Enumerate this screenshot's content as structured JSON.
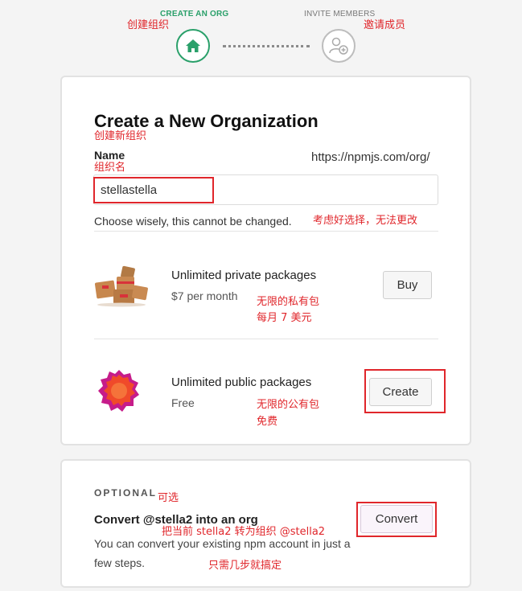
{
  "steps": {
    "create": {
      "label": "CREATE AN ORG",
      "annotation": "创建组织",
      "icon": "home-icon"
    },
    "invite": {
      "label": "INVITE MEMBERS",
      "annotation": "邀请成员",
      "icon": "add-user-icon"
    }
  },
  "form": {
    "title": "Create a New Organization",
    "title_annotation": "创建新组织",
    "name_label": "Name",
    "name_annotation": "组织名",
    "url_prefix": "https://npmjs.com/org/",
    "name_value": "stellastella",
    "hint": "Choose wisely, this cannot be changed.",
    "hint_annotation": "考虑好选择，无法更改"
  },
  "plans": [
    {
      "title": "Unlimited private packages",
      "price": "$7 per month",
      "button": "Buy",
      "annotation_line1": "无限的私有包",
      "annotation_line2": "每月 7 美元",
      "icon": "private-packages-icon"
    },
    {
      "title": "Unlimited public packages",
      "price": "Free",
      "button": "Create",
      "annotation_line1": "无限的公有包",
      "annotation_line2": "免费",
      "icon": "public-packages-icon"
    }
  ],
  "optional": {
    "label": "OPTIONAL",
    "label_annotation": "可选",
    "title": "Convert @stella2 into an org",
    "title_annotation": "把当前 stella2 转为组织 @stella2",
    "description": "You can convert your existing npm account in just a few steps.",
    "description_annotation": "只需几步就搞定",
    "button": "Convert"
  },
  "colors": {
    "accent": "#2aa06a",
    "annotation": "#e0262b",
    "public_badge": "#f04a2a",
    "public_badge_outer": "#c61c8a"
  }
}
